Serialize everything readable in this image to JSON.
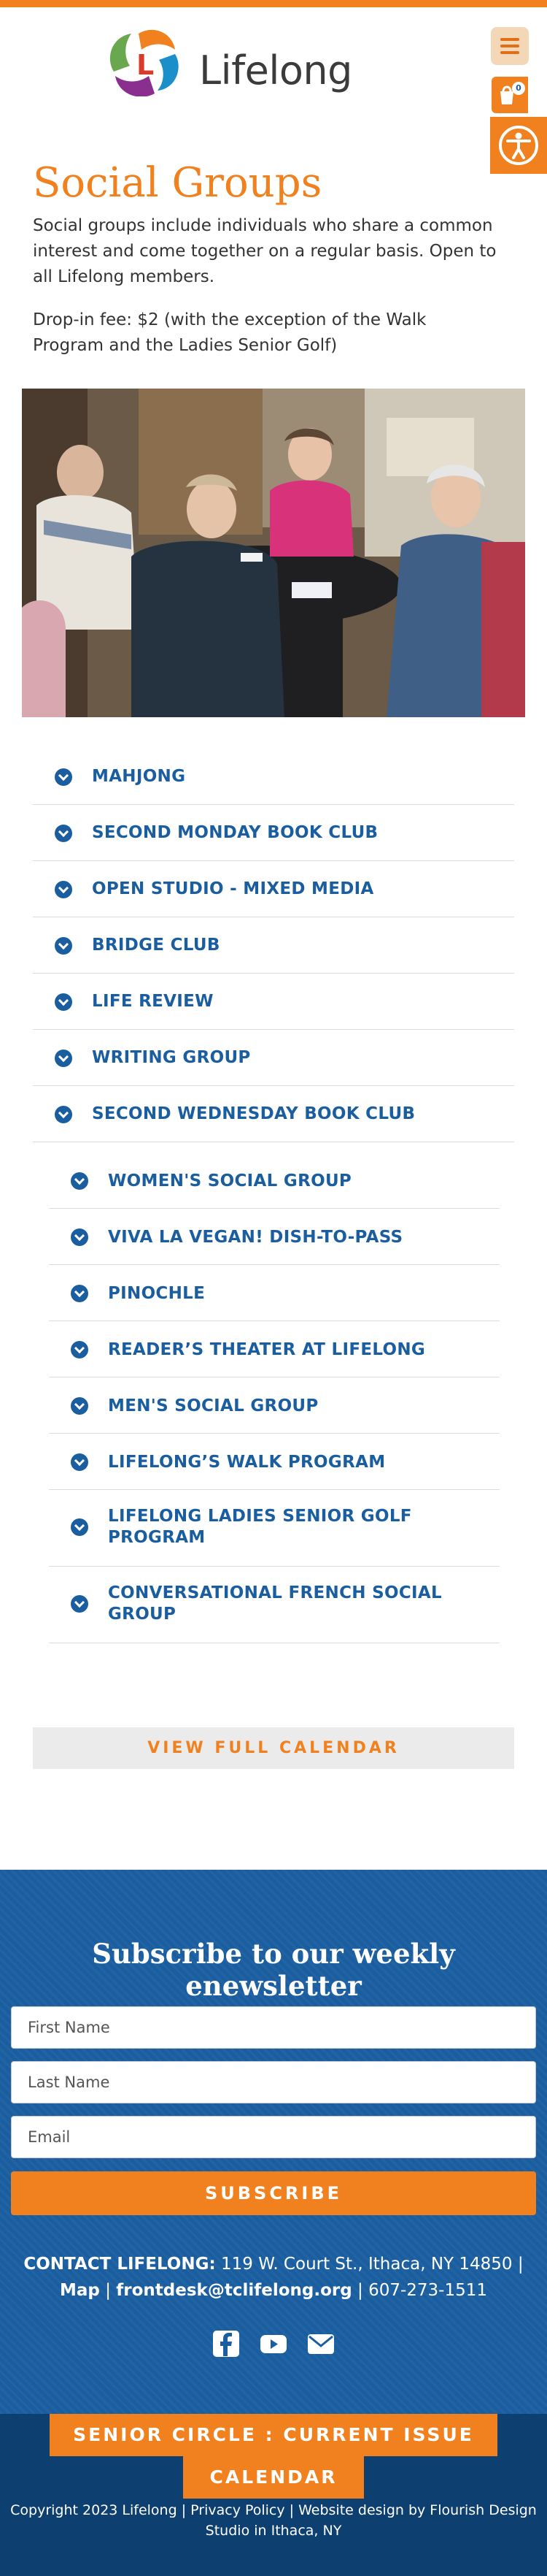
{
  "header": {
    "logo_text": "Lifelong",
    "cart_count": "0",
    "menu_icon": "hamburger-icon",
    "cart_icon": "cart-icon",
    "accessibility_icon": "accessibility-icon"
  },
  "main": {
    "title": "Social Groups",
    "intro": "Social groups include individuals who share a common interest and come together on a regular basis. Open to all Lifelong members.",
    "fee": "Drop-in fee: $2 (with the exception of the Walk Program and the Ladies Senior Golf)",
    "groups": [
      "MAHJONG",
      "SECOND MONDAY BOOK CLUB",
      "OPEN STUDIO - MIXED MEDIA",
      "BRIDGE CLUB",
      "LIFE REVIEW",
      "WRITING GROUP",
      "SECOND WEDNESDAY BOOK CLUB"
    ],
    "nested_groups": [
      "WOMEN'S SOCIAL GROUP",
      "VIVA LA VEGAN! DISH-TO-PASS",
      "PINOCHLE",
      "READER’S THEATER AT LIFELONG",
      "MEN'S SOCIAL GROUP",
      "LIFELONG’S WALK PROGRAM",
      "LIFELONG LADIES SENIOR GOLF PROGRAM",
      "CONVERSATIONAL FRENCH SOCIAL GROUP"
    ],
    "calendar_button": "VIEW FULL CALENDAR"
  },
  "newsletter": {
    "title": "Subscribe to our weekly enewsletter",
    "first_name_placeholder": "First Name",
    "last_name_placeholder": "Last Name",
    "email_placeholder": "Email",
    "subscribe_label": "SUBSCRIBE"
  },
  "contact": {
    "label": "CONTACT LIFELONG:",
    "address": "119 W. Court St., Ithaca, NY 14850",
    "map": "Map",
    "email": "frontdesk@tclifelong.org",
    "phone": "607-273-1511",
    "sep": "|"
  },
  "socials": [
    "facebook-icon",
    "youtube-icon",
    "envelope-icon"
  ],
  "bottom": {
    "senior_circle": "SENIOR CIRCLE : CURRENT ISSUE",
    "calendar": "CALENDAR",
    "copyright": "Copyright 2023 Lifelong | Privacy Policy | Website design by Flourish Design Studio in Ithaca, NY"
  },
  "colors": {
    "brand_orange": "#f0811e",
    "brand_blue": "#1a5ea0",
    "dark_blue": "#0d3f70"
  }
}
